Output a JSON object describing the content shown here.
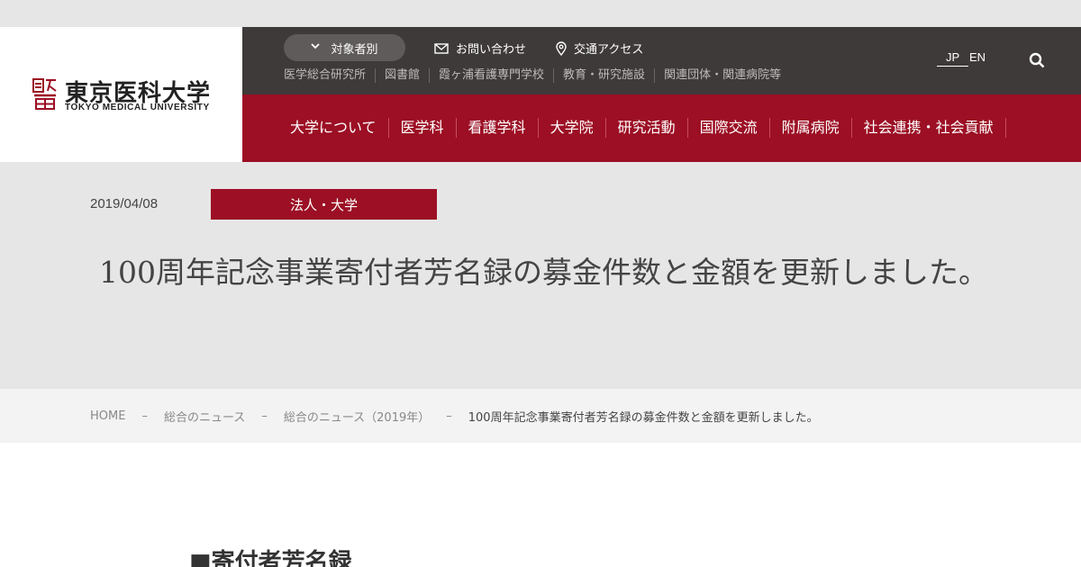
{
  "logo": {
    "jp_text": "東京医科大学",
    "en_text": "TOKYO MEDICAL UNIVERSITY"
  },
  "utility": {
    "target_label": "対象者別",
    "contact_label": "お問い合わせ",
    "access_label": "交通アクセス",
    "sub_links": [
      "医学総合研究所",
      "図書館",
      "霞ヶ浦看護専門学校",
      "教育・研究施設",
      "関連団体・関連病院等"
    ],
    "lang_jp": "JP",
    "lang_en": "EN"
  },
  "nav": {
    "items": [
      "大学について",
      "医学科",
      "看護学科",
      "大学院",
      "研究活動",
      "国際交流",
      "附属病院",
      "社会連携・社会貢献"
    ]
  },
  "post": {
    "date": "2019/04/08",
    "category": "法人・大学",
    "title": "100周年記念事業寄付者芳名録の募金件数と金額を更新しました。"
  },
  "breadcrumb": {
    "separator": "–",
    "items": [
      "HOME",
      "総合のニュース",
      "総合のニュース（2019年）"
    ],
    "current": "100周年記念事業寄付者芳名録の募金件数と金額を更新しました。"
  },
  "content": {
    "heading": "■寄付者芳名録"
  },
  "colors": {
    "brand_red": "#9c0f24",
    "utility_dark": "#3e3a39",
    "hero_gray": "#e6e6e6"
  },
  "icons": [
    "chevron-down-icon",
    "mail-icon",
    "map-pin-icon",
    "search-icon",
    "university-logo-mark"
  ]
}
